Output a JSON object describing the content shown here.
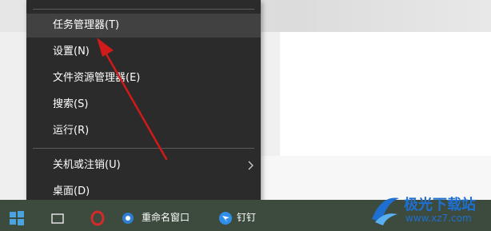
{
  "context_menu": {
    "items": [
      {
        "label": "任务管理器(T)"
      },
      {
        "label": "设置(N)"
      },
      {
        "label": "文件资源管理器(E)"
      },
      {
        "label": "搜索(S)"
      },
      {
        "label": "运行(R)"
      },
      {
        "label": "关机或注销(U)",
        "has_submenu": true,
        "submenu_icon": "chevron-right-icon"
      },
      {
        "label": "桌面(D)"
      }
    ],
    "highlighted_item": "任务管理器(T)"
  },
  "taskbar": {
    "start_icon": "windows-logo-icon",
    "items": [
      {
        "icon": "taskbar-app-icon"
      },
      {
        "icon": "opera-icon"
      },
      {
        "icon": "window-icon",
        "label": "重命名窗口"
      },
      {
        "icon": "ding-icon",
        "label": "钉钉"
      }
    ]
  },
  "annotation": {
    "arrow_color": "#d11a1a",
    "target": "任务管理器(T)"
  },
  "watermark": {
    "title": "极光下载站",
    "url": "www.xz7.com",
    "color": "#1f6fd1"
  }
}
